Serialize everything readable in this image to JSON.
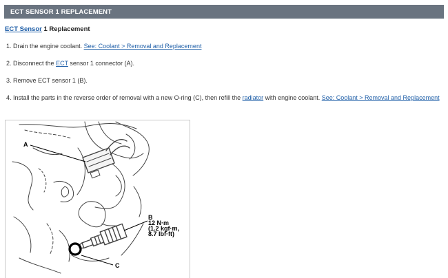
{
  "header": {
    "title": "ECT SENSOR 1 REPLACEMENT"
  },
  "subtitle": {
    "link": "ECT Sensor",
    "rest": " 1 Replacement"
  },
  "steps": [
    {
      "num": "1.",
      "text": " Drain the engine coolant. ",
      "link": "See: Coolant > Removal and Replacement"
    },
    {
      "num": "2.",
      "pre": " Disconnect the ",
      "link": "ECT",
      "post": " sensor 1 connector (A)."
    },
    {
      "num": "3.",
      "text": " Remove ECT sensor 1 (B)."
    },
    {
      "num": "4.",
      "pre": " Install the parts in the reverse order of removal with a new O-ring (C), then refill the ",
      "link": "radiator",
      "post": " with engine coolant. ",
      "link2": "See: Coolant > Removal and Replacement"
    }
  ],
  "figure": {
    "label_a": "A",
    "label_b": "B",
    "torque_1": "12 N·m",
    "torque_2": "(1.2 kgf·m,",
    "torque_3": "8.7 lbf·ft)",
    "label_c": "C"
  }
}
